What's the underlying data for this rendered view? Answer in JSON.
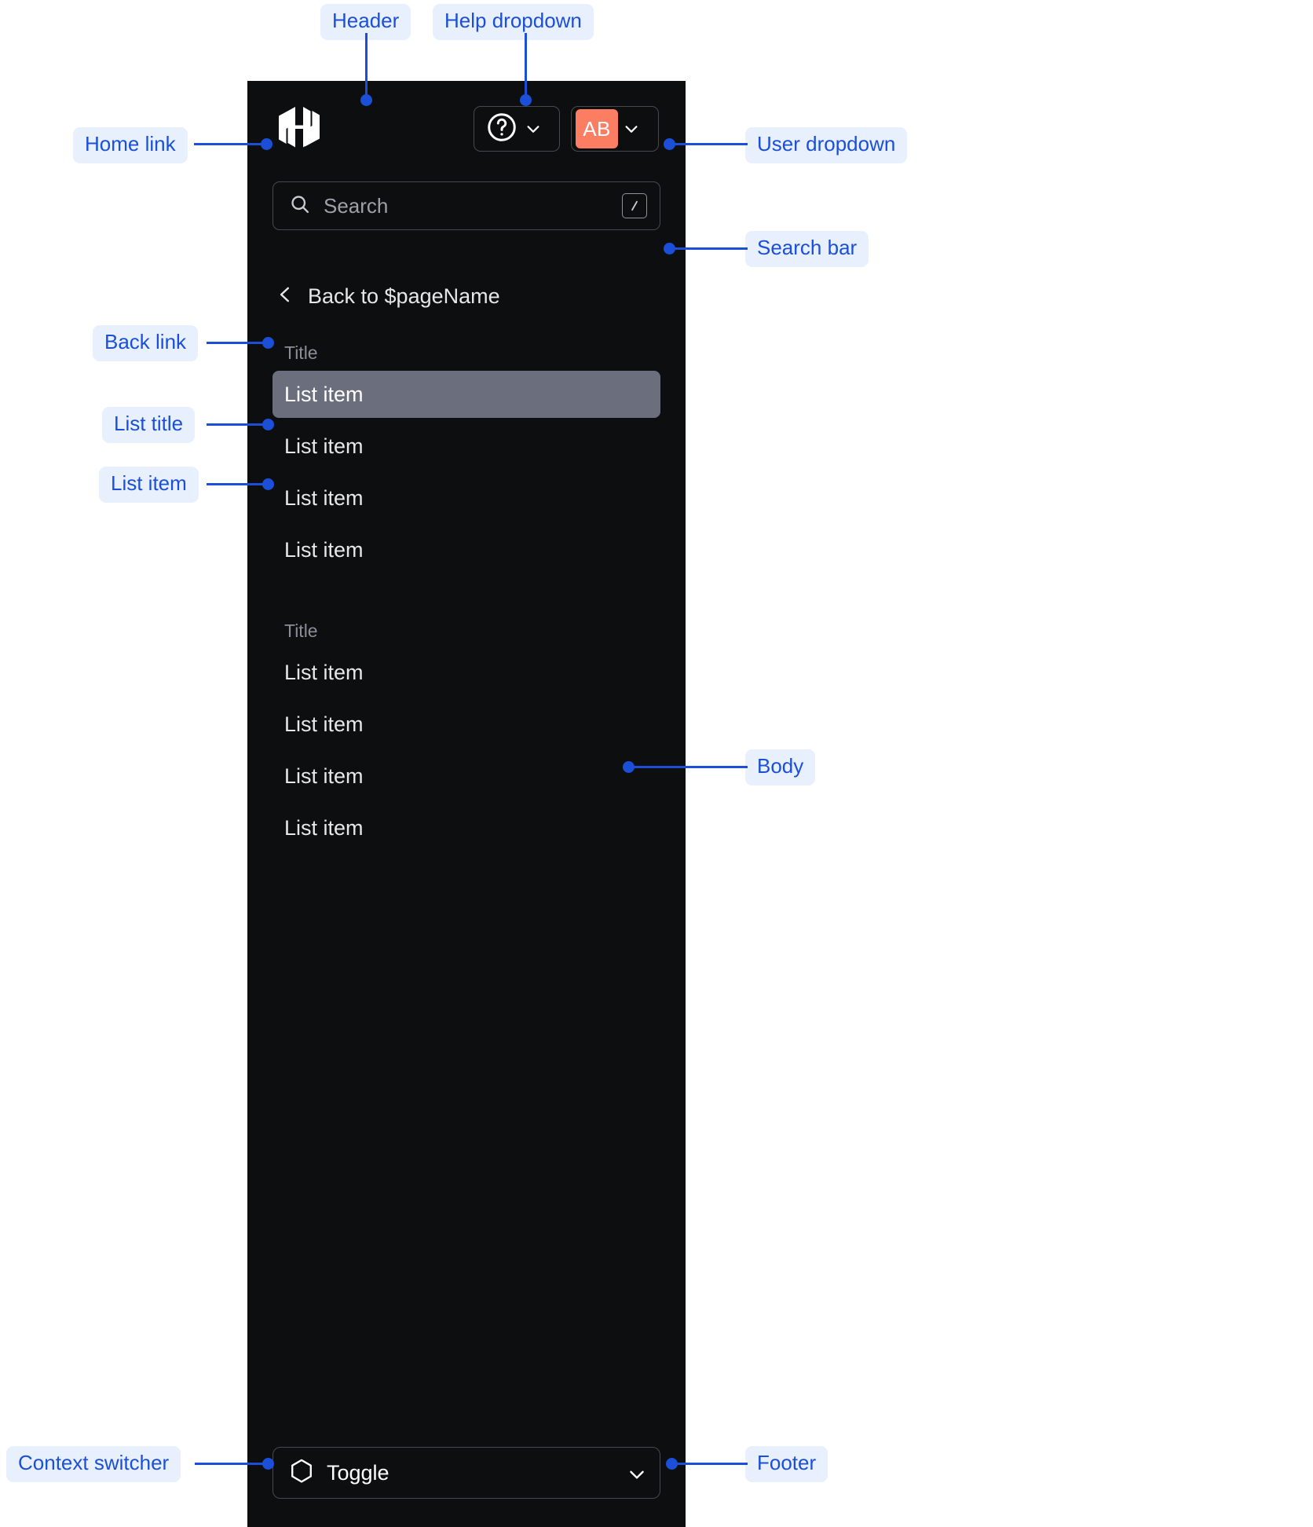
{
  "sidebar": {
    "header": {
      "home_link_icon": "hashicorp-logo-icon",
      "help_dropdown": {
        "icon": "help-circle-icon",
        "chevron": "chevron-down-icon"
      },
      "user_dropdown": {
        "avatar_initials": "AB",
        "avatar_color": "#FB7E62",
        "chevron": "chevron-down-icon"
      }
    },
    "search": {
      "icon": "search-icon",
      "placeholder": "Search",
      "shortcut_badge": "/"
    },
    "back_link": {
      "icon": "chevron-left-icon",
      "label": "Back to $pageName"
    },
    "groups": [
      {
        "title": "Title",
        "items": [
          {
            "label": "List item",
            "active": true
          },
          {
            "label": "List item",
            "active": false
          },
          {
            "label": "List item",
            "active": false
          },
          {
            "label": "List item",
            "active": false
          }
        ]
      },
      {
        "title": "Title",
        "items": [
          {
            "label": "List item",
            "active": false
          },
          {
            "label": "List item",
            "active": false
          },
          {
            "label": "List item",
            "active": false
          },
          {
            "label": "List item",
            "active": false
          }
        ]
      }
    ],
    "footer": {
      "context_switcher": {
        "icon": "hexagon-icon",
        "label": "Toggle",
        "chevron": "chevron-down-icon"
      }
    },
    "colors": {
      "panel_bg": "#0D0E10",
      "border": "#47494D",
      "active_item_bg": "#6B6F7D",
      "muted_text": "#8A8E96",
      "text": "#E6E7E9"
    }
  },
  "annotations": {
    "accent_color": "#1B4FD8",
    "pill_bg": "#E8F0FE",
    "labels": {
      "header": "Header",
      "help_dropdown": "Help dropdown",
      "home_link": "Home link",
      "user_dropdown": "User dropdown",
      "search_bar": "Search bar",
      "back_link": "Back link",
      "list_title": "List title",
      "list_item": "List item",
      "body": "Body",
      "context_switcher": "Context switcher",
      "footer": "Footer"
    }
  }
}
